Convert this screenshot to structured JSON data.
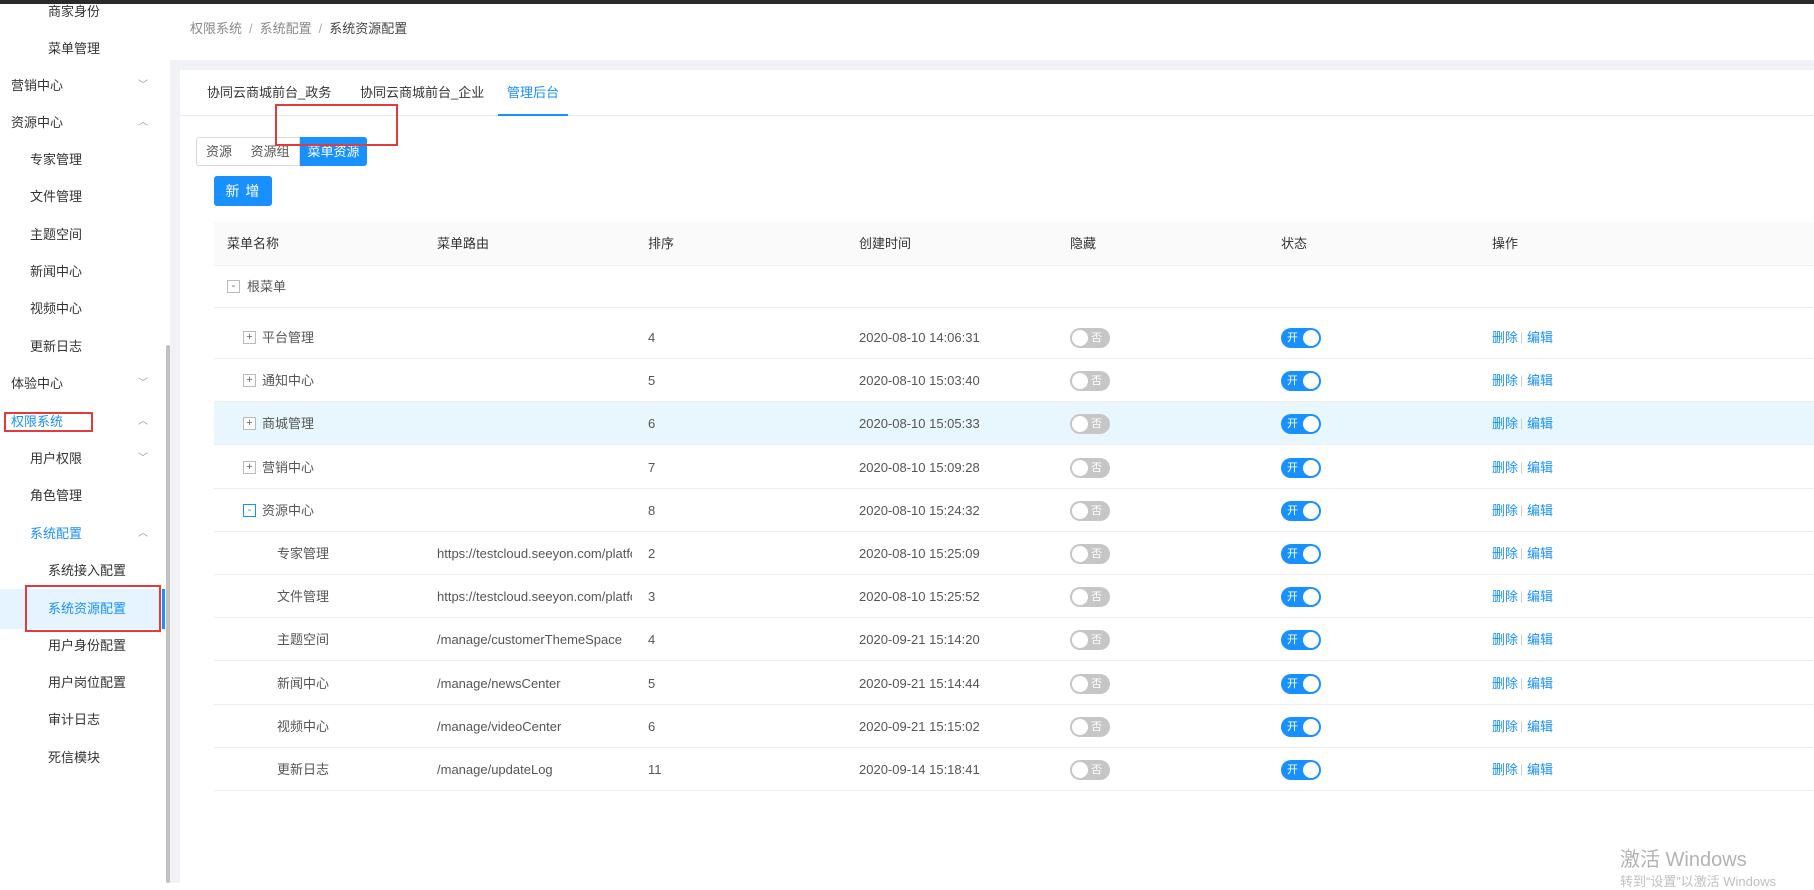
{
  "breadcrumb": [
    "权限系统",
    "系统配置",
    "系统资源配置"
  ],
  "sidebar": [
    {
      "label": "商家身份",
      "level": 2
    },
    {
      "label": "菜单管理",
      "level": 2
    },
    {
      "label": "营销中心",
      "level": 0,
      "arrow": "﹀"
    },
    {
      "label": "资源中心",
      "level": 0,
      "arrow": "︿"
    },
    {
      "label": "专家管理",
      "level": 1
    },
    {
      "label": "文件管理",
      "level": 1
    },
    {
      "label": "主题空间",
      "level": 1
    },
    {
      "label": "新闻中心",
      "level": 1
    },
    {
      "label": "视频中心",
      "level": 1
    },
    {
      "label": "更新日志",
      "level": 1
    },
    {
      "label": "体验中心",
      "level": 0,
      "arrow": "﹀"
    },
    {
      "label": "权限系统",
      "level": 0,
      "arrow": "︿",
      "active": true
    },
    {
      "label": "用户权限",
      "level": 1,
      "arrow": "﹀"
    },
    {
      "label": "角色管理",
      "level": 1
    },
    {
      "label": "系统配置",
      "level": 1,
      "arrow": "︿",
      "active": true
    },
    {
      "label": "系统接入配置",
      "level": 2
    },
    {
      "label": "系统资源配置",
      "level": 2,
      "active": true,
      "selected": true
    },
    {
      "label": "用户身份配置",
      "level": 2
    },
    {
      "label": "用户岗位配置",
      "level": 2
    },
    {
      "label": "审计日志",
      "level": 2
    },
    {
      "label": "死信模块",
      "level": 2
    }
  ],
  "tabs": [
    "协同云商城前台_政务",
    "协同云商城前台_企业",
    "管理后台"
  ],
  "active_tab": 2,
  "segments": [
    "资源",
    "资源组",
    "菜单资源"
  ],
  "active_segment": 2,
  "add_button": "新 增",
  "columns": [
    "菜单名称",
    "菜单路由",
    "排序",
    "创建时间",
    "隐藏",
    "状态",
    "操作"
  ],
  "root": {
    "expander": "-",
    "name": "根菜单"
  },
  "rows": [
    {
      "expander": "+",
      "indent": 1,
      "name": "平台管理",
      "route": "",
      "sort": "4",
      "created": "2020-08-10 14:06:31"
    },
    {
      "expander": "+",
      "indent": 1,
      "name": "通知中心",
      "route": "",
      "sort": "5",
      "created": "2020-08-10 15:03:40"
    },
    {
      "expander": "+",
      "indent": 1,
      "name": "商城管理",
      "route": "",
      "sort": "6",
      "created": "2020-08-10 15:05:33",
      "highlight": true
    },
    {
      "expander": "+",
      "indent": 1,
      "name": "营销中心",
      "route": "",
      "sort": "7",
      "created": "2020-08-10 15:09:28"
    },
    {
      "expander": "-",
      "indent": 1,
      "name": "资源中心",
      "route": "",
      "sort": "8",
      "created": "2020-08-10 15:24:32",
      "blue_expander": true
    },
    {
      "indent": 2,
      "name": "专家管理",
      "route": "https://testcloud.seeyon.com/platfor...",
      "sort": "2",
      "created": "2020-08-10 15:25:09"
    },
    {
      "indent": 2,
      "name": "文件管理",
      "route": "https://testcloud.seeyon.com/platfor...",
      "sort": "3",
      "created": "2020-08-10 15:25:52"
    },
    {
      "indent": 2,
      "name": "主题空间",
      "route": "/manage/customerThemeSpace",
      "sort": "4",
      "created": "2020-09-21 15:14:20"
    },
    {
      "indent": 2,
      "name": "新闻中心",
      "route": "/manage/newsCenter",
      "sort": "5",
      "created": "2020-09-21 15:14:44"
    },
    {
      "indent": 2,
      "name": "视频中心",
      "route": "/manage/videoCenter",
      "sort": "6",
      "created": "2020-09-21 15:15:02"
    },
    {
      "indent": 2,
      "name": "更新日志",
      "route": "/manage/updateLog",
      "sort": "11",
      "created": "2020-09-14 15:18:41"
    }
  ],
  "switch_off_text": "否",
  "switch_on_text": "开",
  "action_delete": "删除",
  "action_edit": "编辑",
  "watermark": "激活 Windows",
  "watermark_sub": "转到“设置”以激活 Windows",
  "colors": {
    "accent": "#1890ff",
    "highlight_row": "#e8f6fd",
    "annotation_red": "#e23b3b"
  }
}
